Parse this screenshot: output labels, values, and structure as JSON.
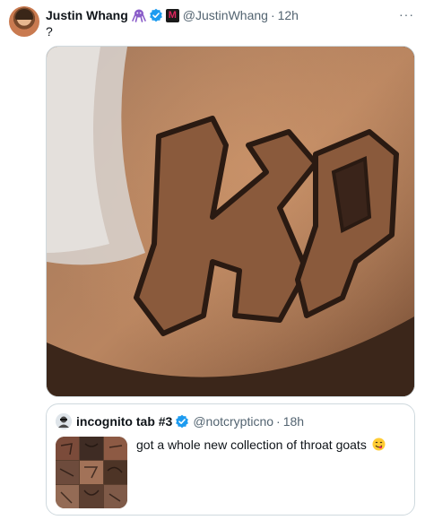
{
  "tweet": {
    "author_name": "Justin Whang",
    "author_handle": "@JustinWhang",
    "separator": "·",
    "time": "12h",
    "text": "?",
    "more_icon": "more-icon",
    "badges": [
      "octopus-icon",
      "verified-icon",
      "m-badge-icon"
    ],
    "m_badge_letter": "M",
    "media_alt": "neck tattoo photo",
    "media_tattoo_letters": "KP"
  },
  "quote": {
    "author_name": "incognito tab #3",
    "author_handle": "@notcrypticno",
    "separator": "·",
    "time": "18h",
    "text": "got a whole new collection of throat goats",
    "emoji": "face-savoring-food-emoji"
  },
  "colors": {
    "verified_blue": "#1d9bf0",
    "secondary_text": "#536471",
    "border": "#cfd9de",
    "octopus_purple": "#8a5cc9"
  }
}
